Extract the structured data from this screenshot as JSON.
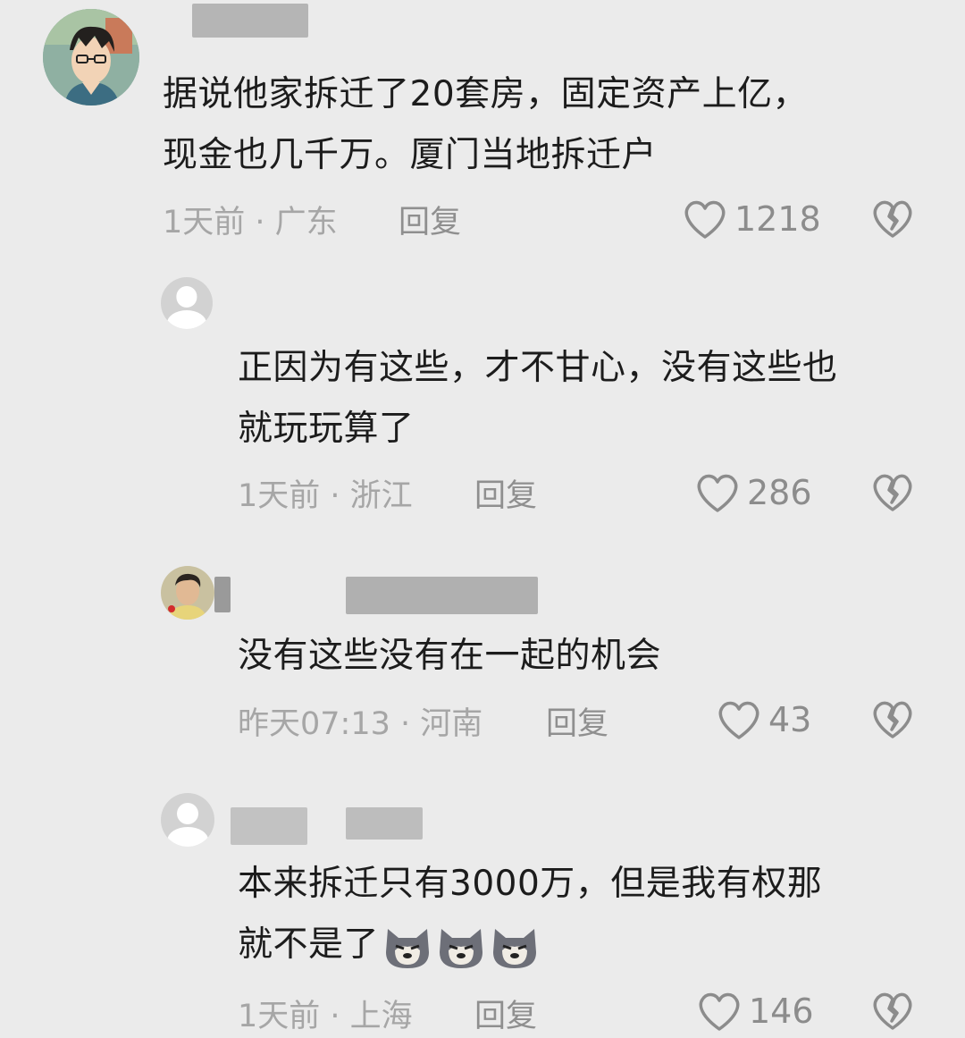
{
  "comments": [
    {
      "text_line1": "据说他家拆迁了20套房，固定资产上亿，",
      "text_line2": "现金也几千万。厦门当地拆迁户",
      "time_location": "1天前 · 广东",
      "reply_label": "回复",
      "likes": "1218",
      "avatar_icon": "anime-avatar-icon"
    },
    {
      "text_line1": "正因为有这些，才不甘心，没有这些也",
      "text_line2": "就玩玩算了",
      "time_location": "1天前 · 浙江",
      "reply_label": "回复",
      "likes": "286",
      "avatar_icon": "default-avatar-icon"
    },
    {
      "text_line1": "没有这些没有在一起的机会",
      "time_location": "昨天07:13 · 河南",
      "reply_label": "回复",
      "likes": "43",
      "avatar_icon": "photo-avatar-icon"
    },
    {
      "text_line1": "本来拆迁只有3000万，但是我有权那",
      "text_line2": "就不是了",
      "emojis": [
        "dog-face-emoji",
        "dog-face-emoji",
        "dog-face-emoji"
      ],
      "time_location": "1天前 · 上海",
      "reply_label": "回复",
      "likes": "146",
      "avatar_icon": "default-avatar-icon"
    }
  ],
  "colors": {
    "background": "#ebebeb",
    "text": "#1c1c1c",
    "meta": "#a6a6a6",
    "icon": "#8c8c8c"
  }
}
